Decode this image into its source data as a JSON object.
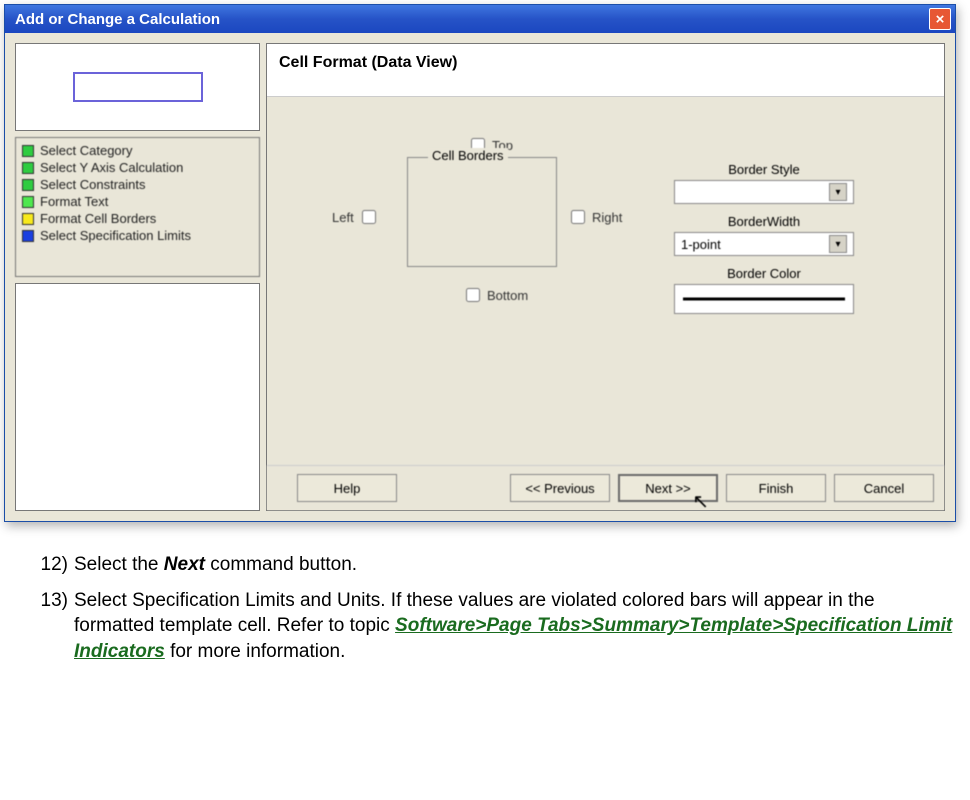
{
  "window": {
    "title": "Add or Change a Calculation"
  },
  "sidebar": {
    "steps": [
      {
        "color": "green",
        "label": "Select Category"
      },
      {
        "color": "green",
        "label": "Select Y Axis Calculation"
      },
      {
        "color": "green",
        "label": "Select Constraints"
      },
      {
        "color": "lime",
        "label": "Format Text"
      },
      {
        "color": "yellow",
        "label": "Format Cell Borders"
      },
      {
        "color": "blue",
        "label": "Select Specification Limits"
      }
    ]
  },
  "main": {
    "header": "Cell Format (Data View)",
    "cell_borders_legend": "Cell Borders",
    "chk_top": "Top",
    "chk_left": "Left",
    "chk_right": "Right",
    "chk_bottom": "Bottom",
    "label_style": "Border Style",
    "label_width": "BorderWidth",
    "width_value": "1-point",
    "label_color": "Border Color"
  },
  "buttons": {
    "help": "Help",
    "previous": "<< Previous",
    "next": "Next >>",
    "finish": "Finish",
    "cancel": "Cancel"
  },
  "instructions": {
    "n12": "12)",
    "t12a": "Select the ",
    "t12b": "Next",
    "t12c": " command button.",
    "n13": "13)",
    "t13a": "Select Specification Limits and Units. If these values are violated colored bars will appear in the formatted template cell. Refer to   topic ",
    "t13b": "Software>Page Tabs>Summary>Template>Specification Limit Indicators",
    "t13c": " for more information."
  }
}
